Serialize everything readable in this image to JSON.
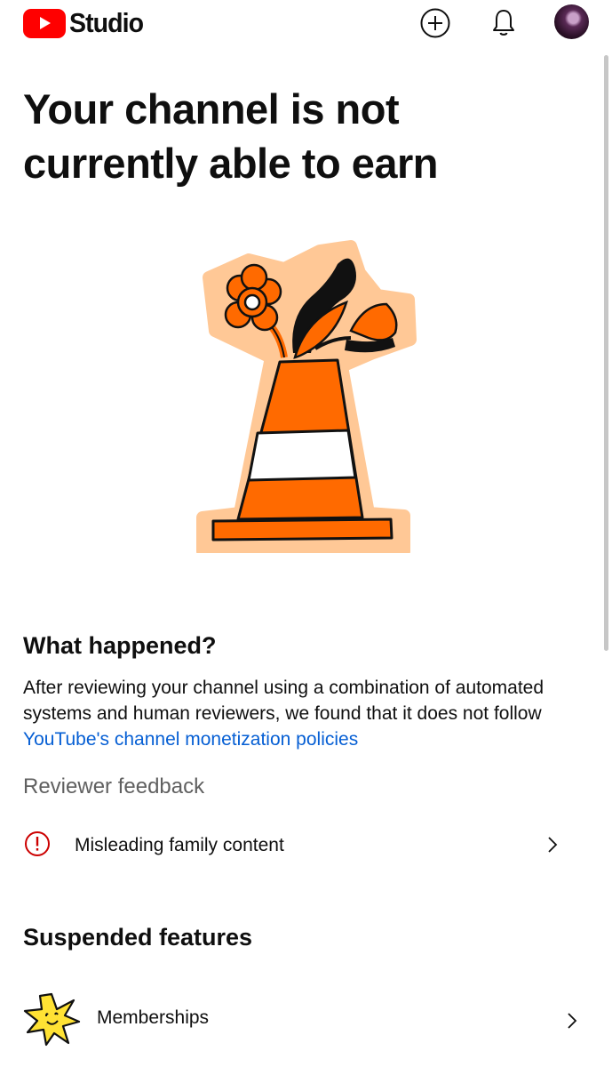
{
  "header": {
    "brand_label": "Studio",
    "icons": [
      "youtube-logo-icon",
      "create-plus-icon",
      "notifications-bell-icon",
      "account-avatar"
    ]
  },
  "main": {
    "title": "Your channel is not currently able to earn",
    "what_happened": {
      "heading": "What happened?",
      "body_prefix": "After reviewing your channel using a combination of automated systems and human reviewers, we found that it does not follow ",
      "link_text": "YouTube's channel monetization policies"
    },
    "reviewer_feedback": {
      "label": "Reviewer feedback",
      "items": [
        {
          "label": "Misleading family content",
          "icon": "alert-circle-icon"
        }
      ]
    },
    "suspended_features": {
      "heading": "Suspended features",
      "items": [
        {
          "label": "Memberships",
          "icon": "memberships-star-icon"
        }
      ]
    }
  },
  "colors": {
    "brand_red": "#ff0000",
    "link_blue": "#065fd4",
    "alert_red": "#cc0000",
    "secondary_text": "#606060",
    "cone_orange": "#ff6a00",
    "cone_glow": "#ffc896"
  }
}
